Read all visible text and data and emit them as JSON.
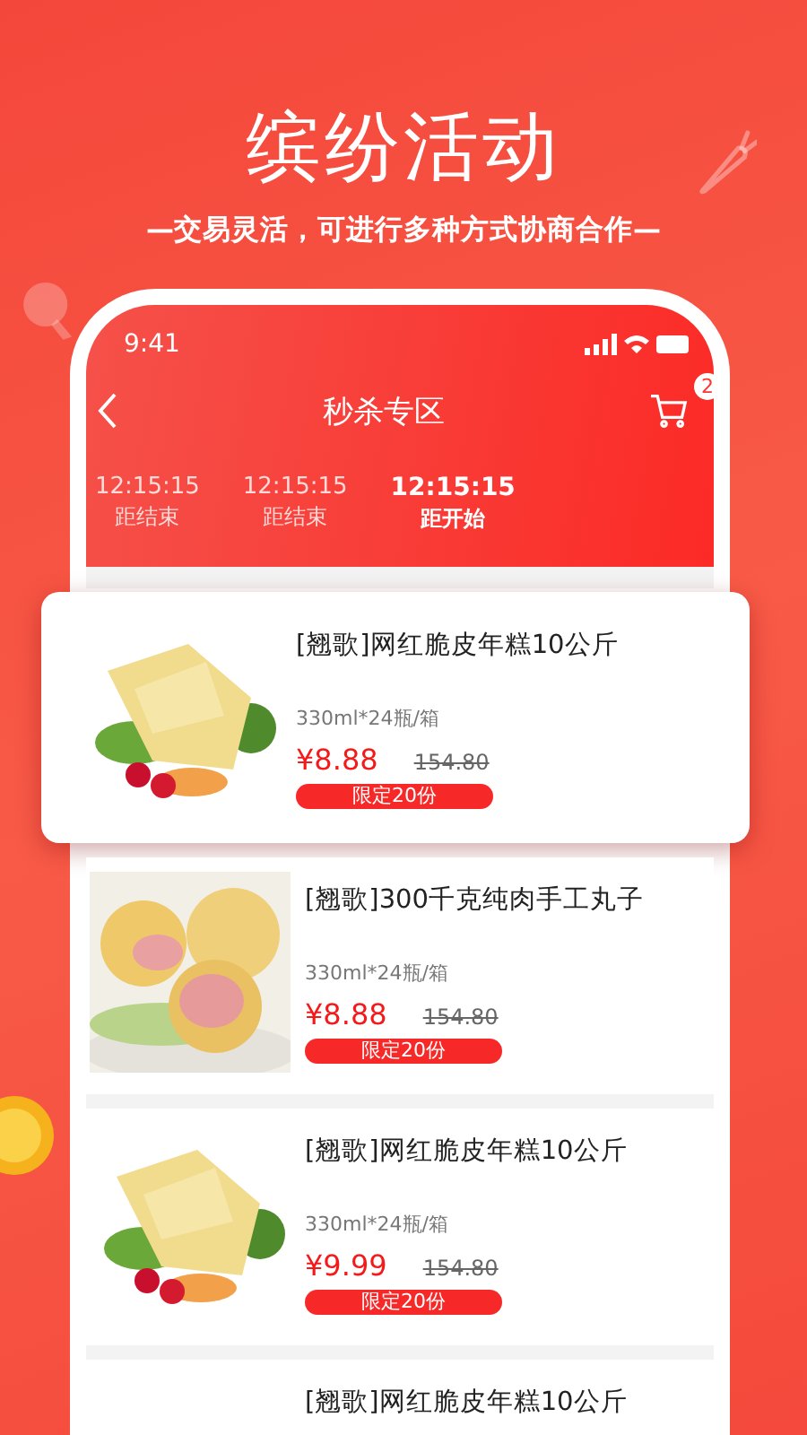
{
  "headline": "缤纷活动",
  "subtitle": "—交易灵活，可进行多种方式协商合作—",
  "status_bar": {
    "time": "9:41"
  },
  "nav": {
    "title": "秒杀专区",
    "cart_count": "2"
  },
  "timers": [
    {
      "time": "12:15:15",
      "label": "距结束",
      "selected": false
    },
    {
      "time": "12:15:15",
      "label": "距结束",
      "selected": false
    },
    {
      "time": "12:15:15",
      "label": "距开始",
      "selected": true
    }
  ],
  "products": [
    {
      "title": "[翘歌]网红脆皮年糕10公斤",
      "spec": "330ml*24瓶/箱",
      "price": "¥8.88",
      "old_price": "154.80",
      "limit": "限定20份",
      "highlighted": true
    },
    {
      "title": "[翘歌]300千克纯肉手工丸子",
      "spec": "330ml*24瓶/箱",
      "price": "¥8.88",
      "old_price": "154.80",
      "limit": "限定20份",
      "highlighted": false
    },
    {
      "title": "[翘歌]网红脆皮年糕10公斤",
      "spec": "330ml*24瓶/箱",
      "price": "¥9.99",
      "old_price": "154.80",
      "limit": "限定20份",
      "highlighted": false
    },
    {
      "title": "[翘歌]网红脆皮年糕10公斤",
      "highlighted": false
    }
  ]
}
